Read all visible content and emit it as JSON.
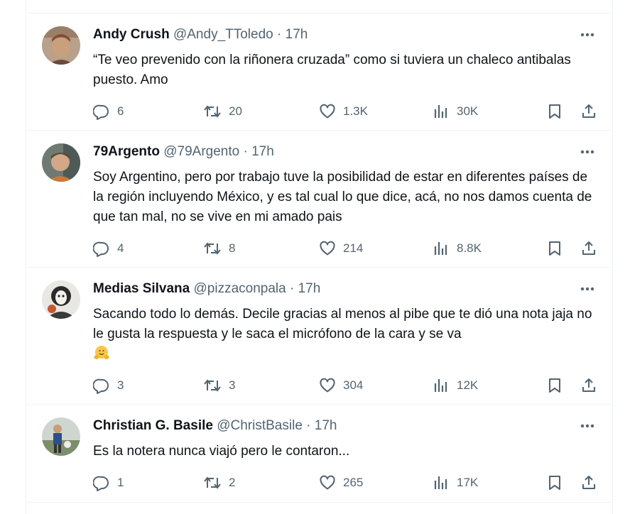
{
  "replies": [
    {
      "name": "Andy Crush",
      "handle": "@Andy_TToledo",
      "dot": "·",
      "time": "17h",
      "text": "“Te veo prevenido con la riñonera cruzada” como si tuviera un chaleco antibalas puesto. Amo",
      "replies": "6",
      "reposts": "20",
      "likes": "1.3K",
      "views": "30K"
    },
    {
      "name": "79Argento",
      "handle": "@79Argento",
      "dot": "·",
      "time": "17h",
      "text": "Soy Argentino, pero por trabajo tuve la posibilidad de estar en diferentes países de la región incluyendo México, y es tal cual lo que dice, acá, no nos damos cuenta de que tan mal, no se vive en mi amado pais",
      "replies": "4",
      "reposts": "8",
      "likes": "214",
      "views": "8.8K"
    },
    {
      "name": "Medias Silvana",
      "handle": "@pizzaconpala",
      "dot": "·",
      "time": "17h",
      "text": "Sacando todo lo demás. Decile gracias al menos al pibe que te dió una nota jaja no le gusta la respuesta y le saca el micrófono de la cara y se va",
      "emoji": "hugging-face-emoji",
      "replies": "3",
      "reposts": "3",
      "likes": "304",
      "views": "12K"
    },
    {
      "name": "Christian G. Basile",
      "handle": "@ChristBasile",
      "dot": "·",
      "time": "17h",
      "text": "Es la notera nunca viajó pero le contaron...",
      "replies": "1",
      "reposts": "2",
      "likes": "265",
      "views": "17K"
    }
  ],
  "icons": {
    "more": "more-horizontal-icon",
    "reply": "reply-bubble-icon",
    "repost": "repost-arrows-icon",
    "like": "heart-icon",
    "views": "bar-chart-icon",
    "bookmark": "bookmark-icon",
    "share": "share-upload-icon"
  },
  "colors": {
    "text": "#0f1419",
    "secondary": "#536471",
    "divider": "#eff3f4"
  }
}
